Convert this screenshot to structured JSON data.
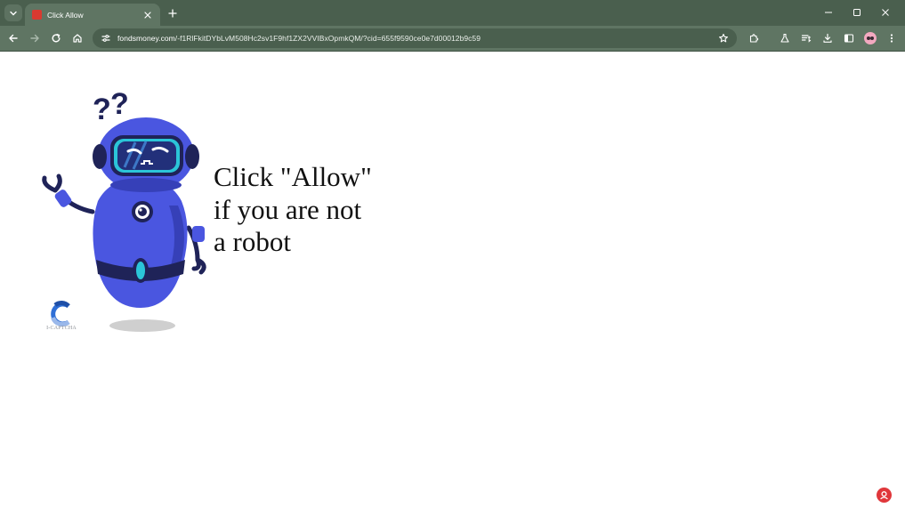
{
  "browser": {
    "tab": {
      "title": "Click Allow",
      "favicon": "red-square-favicon-icon"
    },
    "address_bar": {
      "host": "fondsmoney.com",
      "path": "/-f1RlFkitDYbLvM508Hc2sv1F9hf1ZX2VVIBxOpmkQM/?cid=655f9590ce0e7d00012b9c59"
    },
    "toolbar_icons": [
      "back-icon",
      "forward-icon",
      "reload-icon",
      "home-icon",
      "site-info-icon",
      "bookmark-star-icon",
      "extensions-icon",
      "labs-flask-icon",
      "reading-list-icon",
      "downloads-icon",
      "side-panel-icon",
      "profile-avatar-icon",
      "menu-kebab-icon"
    ],
    "window_controls": [
      "minimize-icon",
      "maximize-icon",
      "close-icon"
    ],
    "theme_colors": {
      "frame": "#4a5f4e",
      "toolbar": "#5f7563"
    }
  },
  "page": {
    "message_lines": [
      "Click \"Allow\"",
      "if you are not",
      "a robot"
    ],
    "captcha_label": "I-CAPTCHA",
    "robot_colors": {
      "body": "#4a56e0",
      "dark": "#1f2358",
      "visor": "#2bc5d8"
    },
    "badge_color": "#e0373b"
  }
}
